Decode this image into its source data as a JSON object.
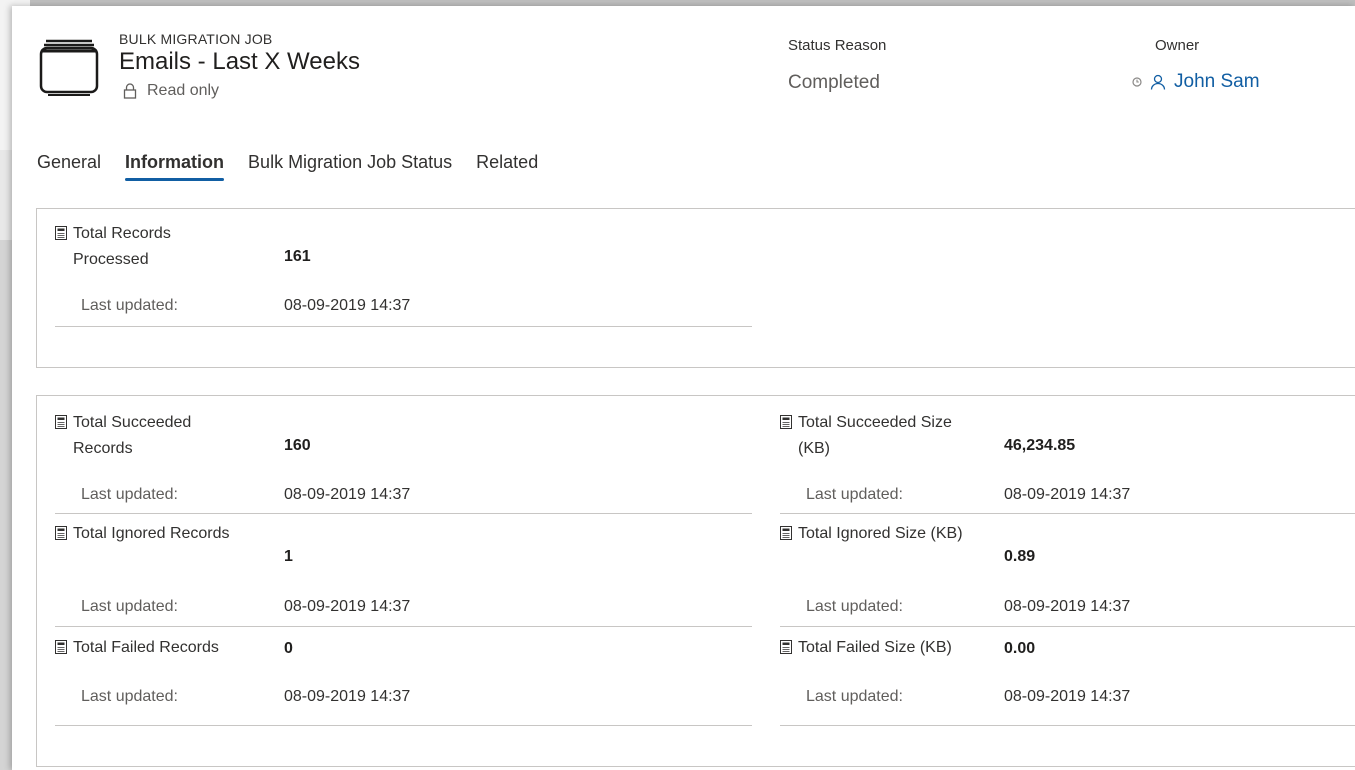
{
  "header": {
    "entity_type": "BULK MIGRATION JOB",
    "title": "Emails - Last X Weeks",
    "read_only": "Read only",
    "icons": {
      "entity": "window-icon",
      "lock": "lock-icon"
    }
  },
  "header_fields": {
    "status_reason": {
      "label": "Status Reason",
      "value": "Completed"
    },
    "owner": {
      "label": "Owner",
      "value": "John Sam",
      "icons": [
        "presence-icon",
        "person-icon"
      ],
      "link_color": "#115ea3"
    }
  },
  "tabs": [
    {
      "label": "General",
      "active": false
    },
    {
      "label": "Information",
      "active": true
    },
    {
      "label": "Bulk Migration Job Status",
      "active": false
    },
    {
      "label": "Related",
      "active": false
    }
  ],
  "section1": {
    "total_records_processed": {
      "label": "Total Records Processed",
      "value": "161",
      "updated_label": "Last updated:",
      "updated_value": "08-09-2019 14:37"
    }
  },
  "section2": {
    "total_succeeded_records": {
      "label": "Total Succeeded Records",
      "value": "160",
      "updated_label": "Last updated:",
      "updated_value": "08-09-2019 14:37"
    },
    "total_succeeded_size": {
      "label": "Total Succeeded Size (KB)",
      "value": "46,234.85",
      "updated_label": "Last updated:",
      "updated_value": "08-09-2019 14:37"
    },
    "total_ignored_records": {
      "label": "Total Ignored Records",
      "value": "1",
      "updated_label": "Last updated:",
      "updated_value": "08-09-2019 14:37"
    },
    "total_ignored_size": {
      "label": "Total Ignored Size (KB)",
      "value": "0.89",
      "updated_label": "Last updated:",
      "updated_value": "08-09-2019 14:37"
    },
    "total_failed_records": {
      "label": "Total Failed Records",
      "value": "0",
      "updated_label": "Last updated:",
      "updated_value": "08-09-2019 14:37"
    },
    "total_failed_size": {
      "label": "Total Failed Size (KB)",
      "value": "0.00",
      "updated_label": "Last updated:",
      "updated_value": "08-09-2019 14:37"
    }
  },
  "colors": {
    "accent": "#115ea3",
    "divider": "#c8c6c4"
  }
}
